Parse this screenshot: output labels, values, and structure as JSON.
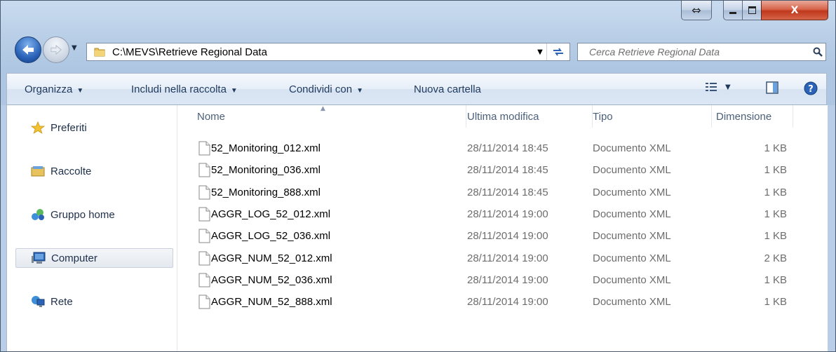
{
  "window": {
    "caption_buttons": {
      "resize_glyph": "⇔",
      "min_glyph": "–",
      "close_glyph": "X"
    }
  },
  "address_bar": {
    "path": "C:\\MEVS\\Retrieve Regional Data",
    "folder_icon": "folder-icon",
    "refresh_icon": "refresh-arrows-icon"
  },
  "search": {
    "placeholder": "Cerca Retrieve Regional Data",
    "icon": "search-icon"
  },
  "command_bar": {
    "organize": "Organizza",
    "include_in_library": "Includi nella raccolta",
    "share_with": "Condividi con",
    "new_folder": "Nuova cartella"
  },
  "nav_pane": {
    "items": [
      {
        "label": "Preferiti",
        "icon": "star-icon"
      },
      {
        "label": "Raccolte",
        "icon": "library-icon"
      },
      {
        "label": "Gruppo home",
        "icon": "homegroup-icon"
      },
      {
        "label": "Computer",
        "icon": "computer-icon"
      },
      {
        "label": "Rete",
        "icon": "network-icon"
      }
    ],
    "selected": "Computer"
  },
  "file_list": {
    "columns": [
      "Nome",
      "Ultima modifica",
      "Tipo",
      "Dimensione"
    ],
    "sort_column": "Nome",
    "rows": [
      {
        "name": "52_Monitoring_012.xml",
        "modified": "28/11/2014 18:45",
        "type": "Documento XML",
        "size": "1 KB"
      },
      {
        "name": "52_Monitoring_036.xml",
        "modified": "28/11/2014 18:45",
        "type": "Documento XML",
        "size": "1 KB"
      },
      {
        "name": "52_Monitoring_888.xml",
        "modified": "28/11/2014 18:45",
        "type": "Documento XML",
        "size": "1 KB"
      },
      {
        "name": "AGGR_LOG_52_012.xml",
        "modified": "28/11/2014 19:00",
        "type": "Documento XML",
        "size": "1 KB"
      },
      {
        "name": "AGGR_LOG_52_036.xml",
        "modified": "28/11/2014 19:00",
        "type": "Documento XML",
        "size": "1 KB"
      },
      {
        "name": "AGGR_NUM_52_012.xml",
        "modified": "28/11/2014 19:00",
        "type": "Documento XML",
        "size": "2 KB"
      },
      {
        "name": "AGGR_NUM_52_036.xml",
        "modified": "28/11/2014 19:00",
        "type": "Documento XML",
        "size": "1 KB"
      },
      {
        "name": "AGGR_NUM_52_888.xml",
        "modified": "28/11/2014 19:00",
        "type": "Documento XML",
        "size": "1 KB"
      }
    ]
  },
  "colors": {
    "accent": "#1e395b",
    "frame": "#b9cde6",
    "close": "#c0381b"
  }
}
